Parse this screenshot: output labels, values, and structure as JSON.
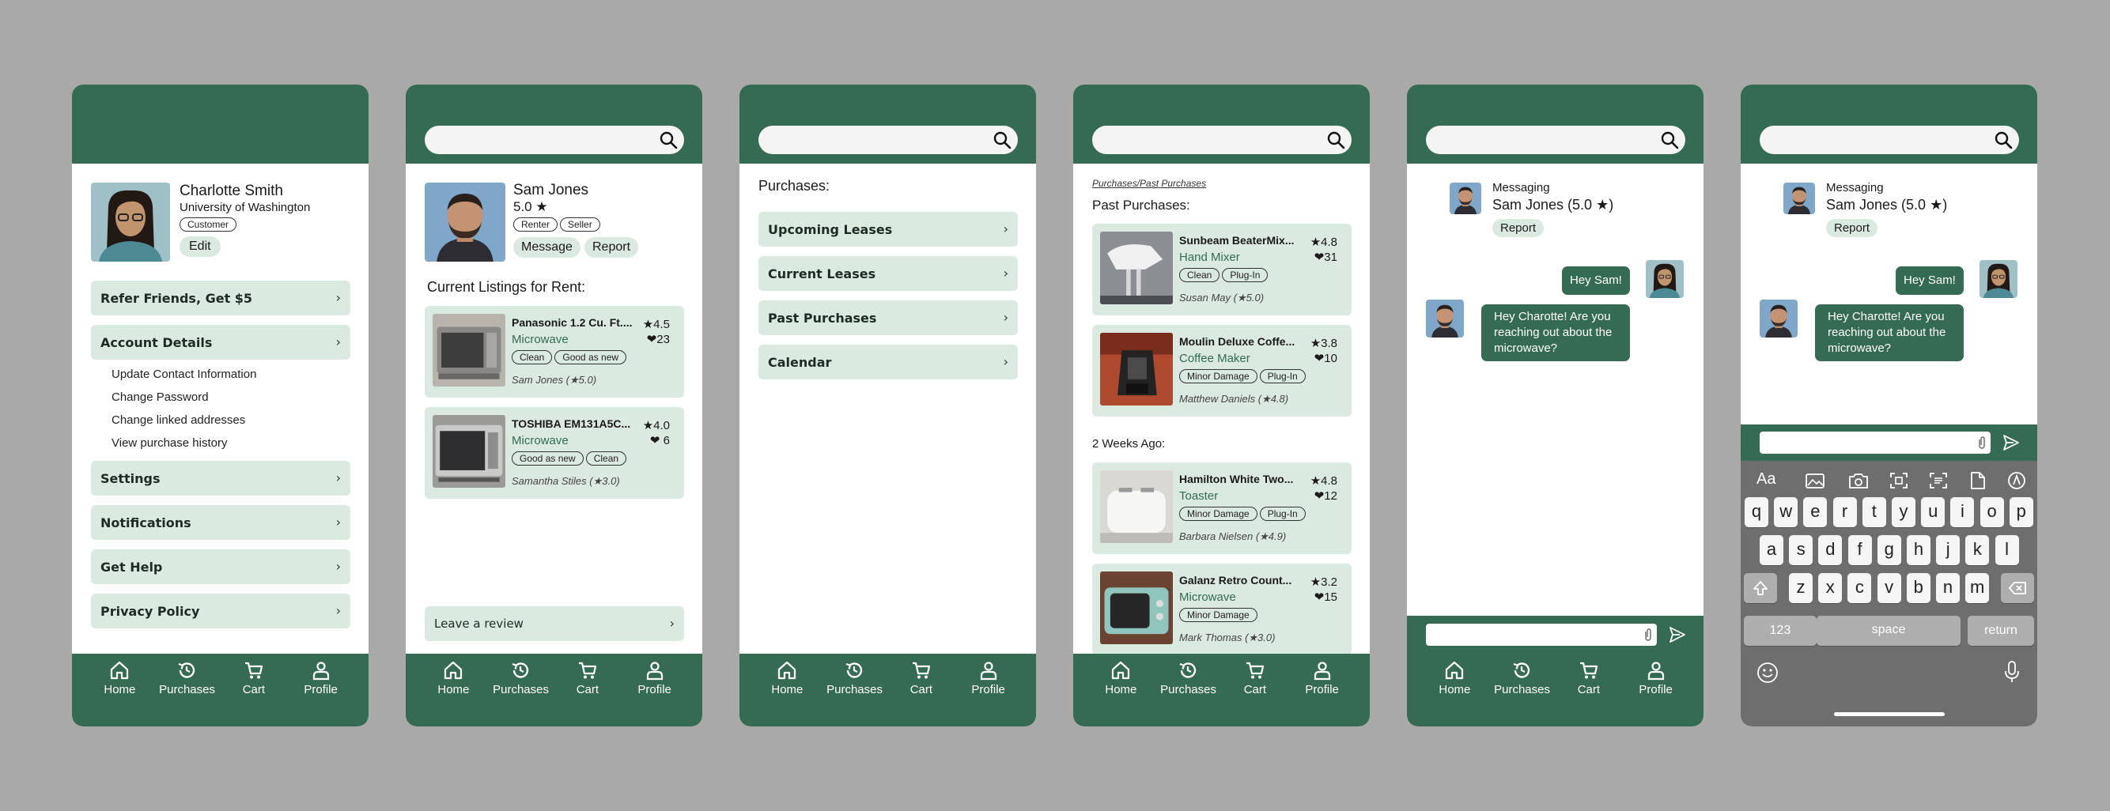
{
  "colors": {
    "brand": "#356b53",
    "card": "#dbeae1",
    "backdrop": "#a9a9a9"
  },
  "nav": [
    {
      "label": "Home",
      "icon": "home-icon"
    },
    {
      "label": "Purchases",
      "icon": "history-icon"
    },
    {
      "label": "Cart",
      "icon": "cart-icon"
    },
    {
      "label": "Profile",
      "icon": "person-icon"
    }
  ],
  "profile": {
    "name": "Charlotte Smith",
    "school": "University of Washington",
    "role": "Customer",
    "edit": "Edit",
    "refer": "Refer Friends, Get $5",
    "account": "Account Details",
    "account_sub": [
      "Update Contact Information",
      "Change Password",
      "Change linked addresses",
      "View purchase history"
    ],
    "settings": "Settings",
    "notifications": "Notifications",
    "help": "Get Help",
    "privacy": "Privacy Policy"
  },
  "seller": {
    "name": "Sam Jones",
    "rating": "5.0 ★",
    "tags": [
      "Renter",
      "Seller"
    ],
    "message": "Message",
    "report": "Report",
    "heading": "Current Listings for Rent:",
    "listings": [
      {
        "title": "Panasonic 1.2 Cu. Ft....",
        "cat": "Microwave",
        "tags": [
          "Clean",
          "Good as new"
        ],
        "seller": "Sam Jones (★5.0)",
        "rating": "★4.5",
        "likes": "❤23"
      },
      {
        "title": "TOSHIBA EM131A5C...",
        "cat": "Microwave",
        "tags": [
          "Good as new",
          "Clean"
        ],
        "seller": "Samantha Stiles (★3.0)",
        "rating": "★4.0",
        "likes": "❤ 6"
      }
    ],
    "review": "Leave a review"
  },
  "purchases": {
    "heading": "Purchases:",
    "items": [
      "Upcoming Leases",
      "Current Leases",
      "Past Purchases",
      "Calendar"
    ]
  },
  "past": {
    "breadcrumb": "Purchases/Past Purchases",
    "heading": "Past Purchases:",
    "section2": "2 Weeks Ago:",
    "items": [
      {
        "title": "Sunbeam BeaterMix...",
        "cat": "Hand Mixer",
        "tags": [
          "Clean",
          "Plug-In"
        ],
        "seller": "Susan May (★5.0)",
        "rating": "★4.8",
        "likes": "❤31"
      },
      {
        "title": "Moulin Deluxe Coffe...",
        "cat": "Coffee Maker",
        "tags": [
          "Minor Damage",
          "Plug-In"
        ],
        "seller": "Matthew Daniels (★4.8)",
        "rating": "★3.8",
        "likes": "❤10"
      },
      {
        "title": "Hamilton White Two...",
        "cat": "Toaster",
        "tags": [
          "Minor Damage",
          "Plug-In"
        ],
        "seller": "Barbara Nielsen (★4.9)",
        "rating": "★4.8",
        "likes": "❤12"
      },
      {
        "title": "Galanz Retro Count...",
        "cat": "Microwave",
        "tags": [
          "Minor Damage"
        ],
        "seller": "Mark Thomas (★3.0)",
        "rating": "★3.2",
        "likes": "❤15"
      }
    ]
  },
  "chat": {
    "title": "Messaging",
    "name": "Sam Jones (5.0 ★)",
    "report": "Report",
    "sent": "Hey Sam!",
    "received": "Hey Charotte! Are you reaching out about the microwave?"
  },
  "keyboard": {
    "tools": [
      "Aa",
      "photo-icon",
      "camera-icon",
      "scan-icon",
      "doc-scan-icon",
      "file-icon",
      "compass-icon"
    ],
    "row1": [
      "q",
      "w",
      "e",
      "r",
      "t",
      "y",
      "u",
      "i",
      "o",
      "p"
    ],
    "row2": [
      "a",
      "s",
      "d",
      "f",
      "g",
      "h",
      "j",
      "k",
      "l"
    ],
    "row3": [
      "z",
      "x",
      "c",
      "v",
      "b",
      "n",
      "m"
    ],
    "numbers": "123",
    "space": "space",
    "return": "return"
  }
}
